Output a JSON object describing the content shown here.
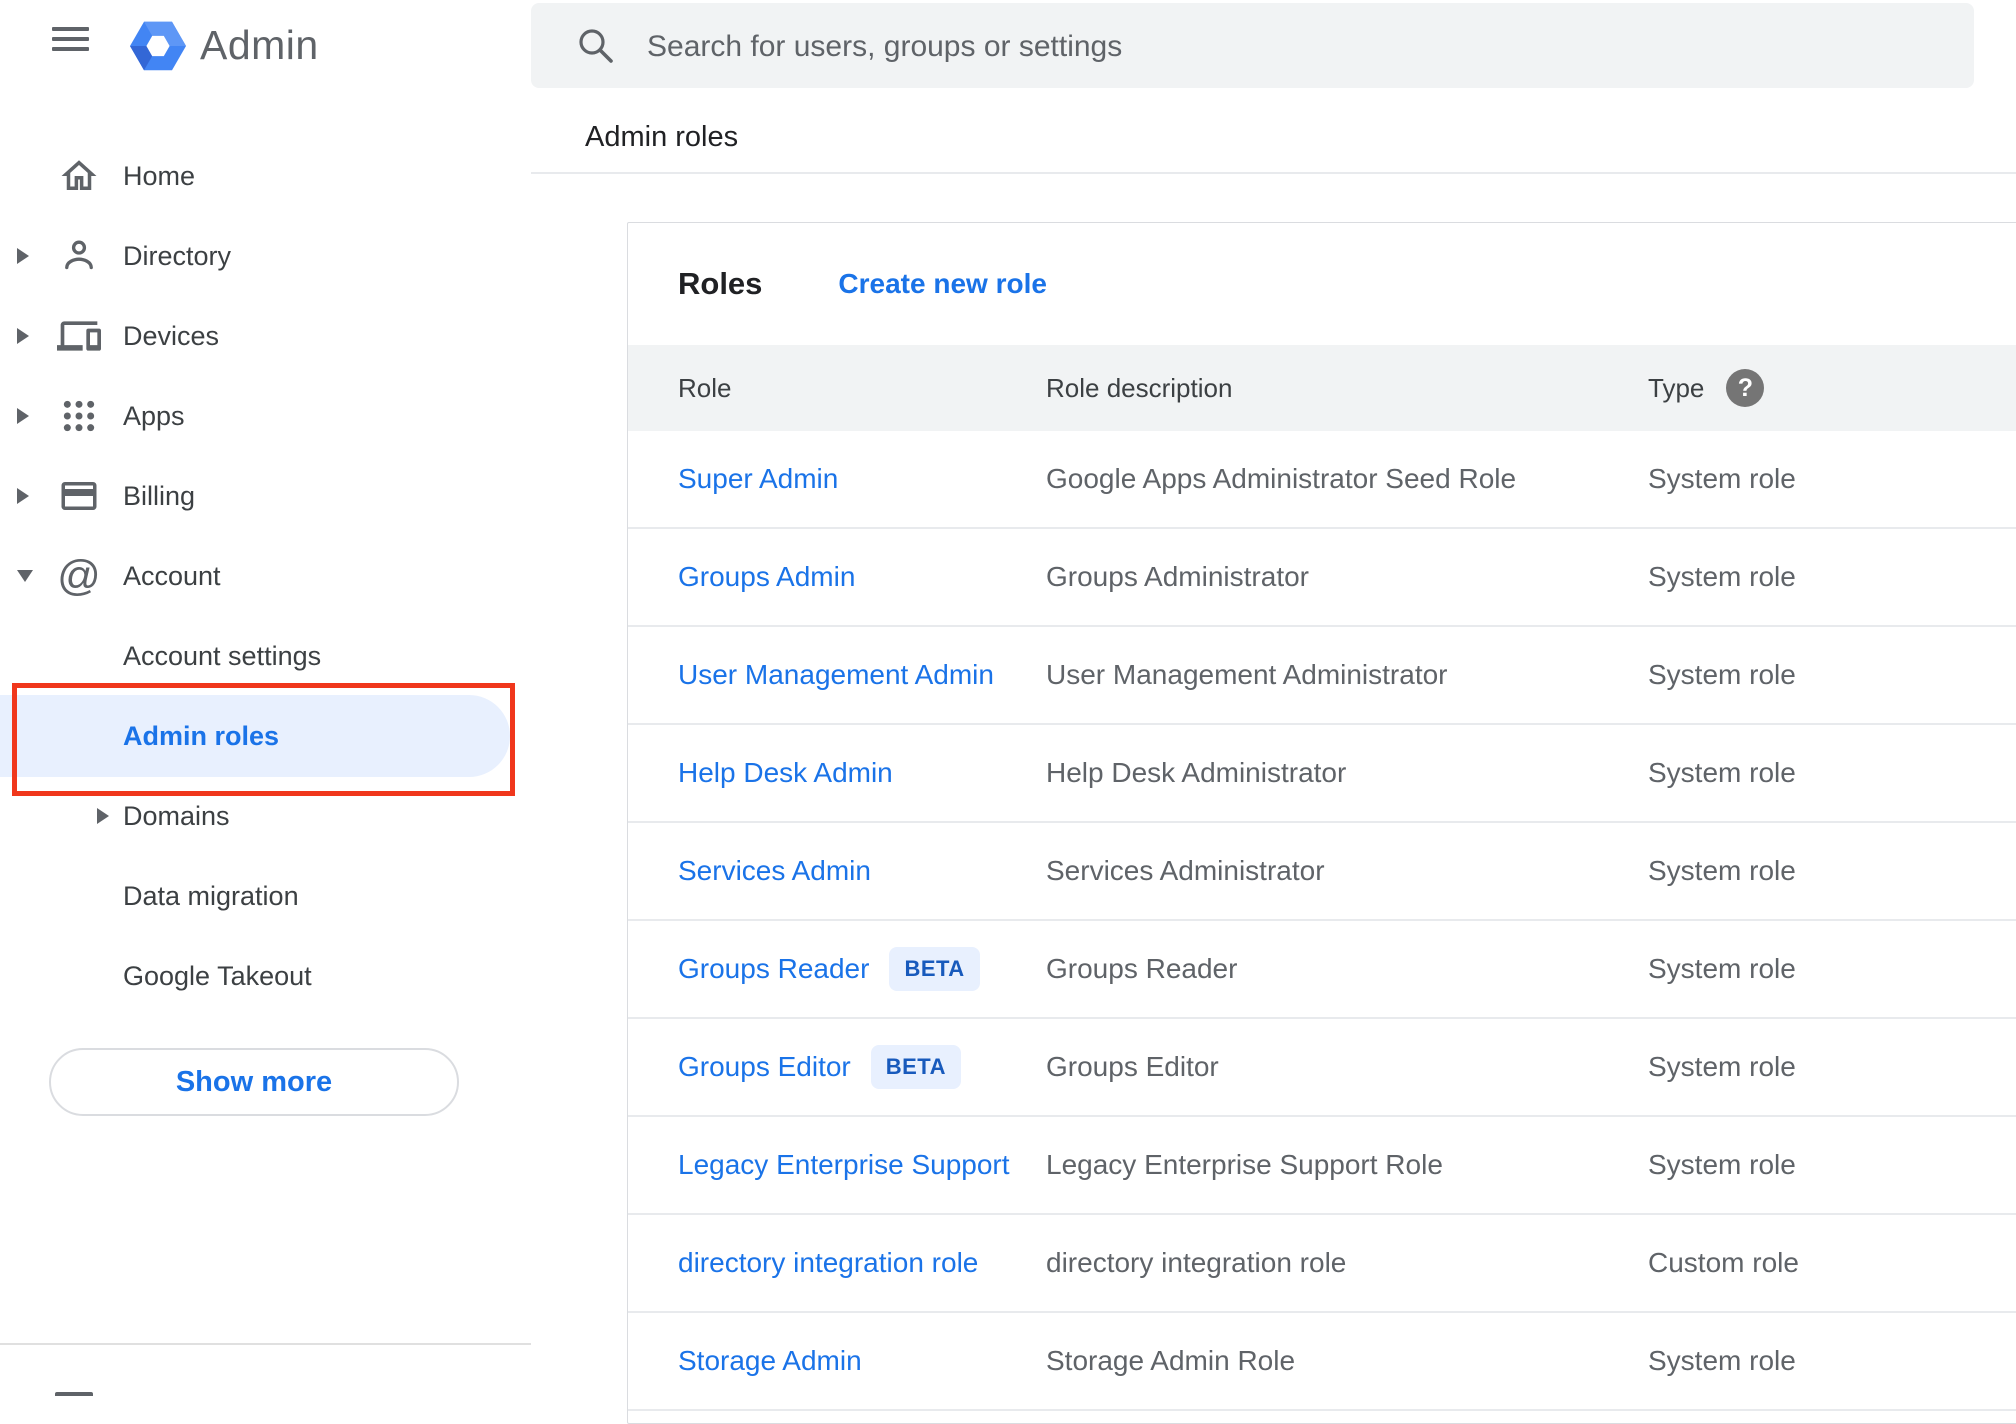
{
  "header": {
    "app_title": "Admin",
    "search_placeholder": "Search for users, groups or settings"
  },
  "breadcrumb": "Admin roles",
  "sidebar": {
    "items": [
      {
        "label": "Home",
        "icon": "home",
        "arrow": null,
        "sub": false,
        "selected": false
      },
      {
        "label": "Directory",
        "icon": "person",
        "arrow": "right",
        "sub": false,
        "selected": false
      },
      {
        "label": "Devices",
        "icon": "devices",
        "arrow": "right",
        "sub": false,
        "selected": false
      },
      {
        "label": "Apps",
        "icon": "apps",
        "arrow": "right",
        "sub": false,
        "selected": false
      },
      {
        "label": "Billing",
        "icon": "card",
        "arrow": "right",
        "sub": false,
        "selected": false
      },
      {
        "label": "Account",
        "icon": "at",
        "arrow": "down",
        "sub": false,
        "selected": false
      },
      {
        "label": "Account settings",
        "icon": null,
        "arrow": null,
        "sub": true,
        "selected": false
      },
      {
        "label": "Admin roles",
        "icon": null,
        "arrow": null,
        "sub": true,
        "selected": true
      },
      {
        "label": "Domains",
        "icon": null,
        "arrow": "right",
        "sub": true,
        "selected": false
      },
      {
        "label": "Data migration",
        "icon": null,
        "arrow": null,
        "sub": true,
        "selected": false
      },
      {
        "label": "Google Takeout",
        "icon": null,
        "arrow": null,
        "sub": true,
        "selected": false
      }
    ],
    "show_more_label": "Show more"
  },
  "roles_panel": {
    "title": "Roles",
    "create_link": "Create new role",
    "columns": [
      "Role",
      "Role description",
      "Type"
    ],
    "beta_badge_label": "BETA",
    "rows": [
      {
        "role": "Super Admin",
        "beta": false,
        "description": "Google Apps Administrator Seed Role",
        "type": "System role"
      },
      {
        "role": "Groups Admin",
        "beta": false,
        "description": "Groups Administrator",
        "type": "System role"
      },
      {
        "role": "User Management Admin",
        "beta": false,
        "description": "User Management Administrator",
        "type": "System role"
      },
      {
        "role": "Help Desk Admin",
        "beta": false,
        "description": "Help Desk Administrator",
        "type": "System role"
      },
      {
        "role": "Services Admin",
        "beta": false,
        "description": "Services Administrator",
        "type": "System role"
      },
      {
        "role": "Groups Reader",
        "beta": true,
        "description": "Groups Reader",
        "type": "System role"
      },
      {
        "role": "Groups Editor",
        "beta": true,
        "description": "Groups Editor",
        "type": "System role"
      },
      {
        "role": "Legacy Enterprise Support",
        "beta": false,
        "description": "Legacy Enterprise Support Role",
        "type": "System role"
      },
      {
        "role": "directory integration role",
        "beta": false,
        "description": "directory integration role",
        "type": "Custom role"
      },
      {
        "role": "Storage Admin",
        "beta": false,
        "description": "Storage Admin Role",
        "type": "System role"
      }
    ]
  },
  "colors": {
    "accent": "#1a73e8",
    "annotation_red": "#f0371c",
    "selected_bg": "#e8f0fe",
    "header_band": "#f1f3f4",
    "icon_gray": "#5f6368"
  },
  "icons": {
    "hamburger": "menu-icon",
    "logo": "admin-hexagon-logo",
    "search": "search-icon",
    "type_help": "help-question-icon"
  }
}
